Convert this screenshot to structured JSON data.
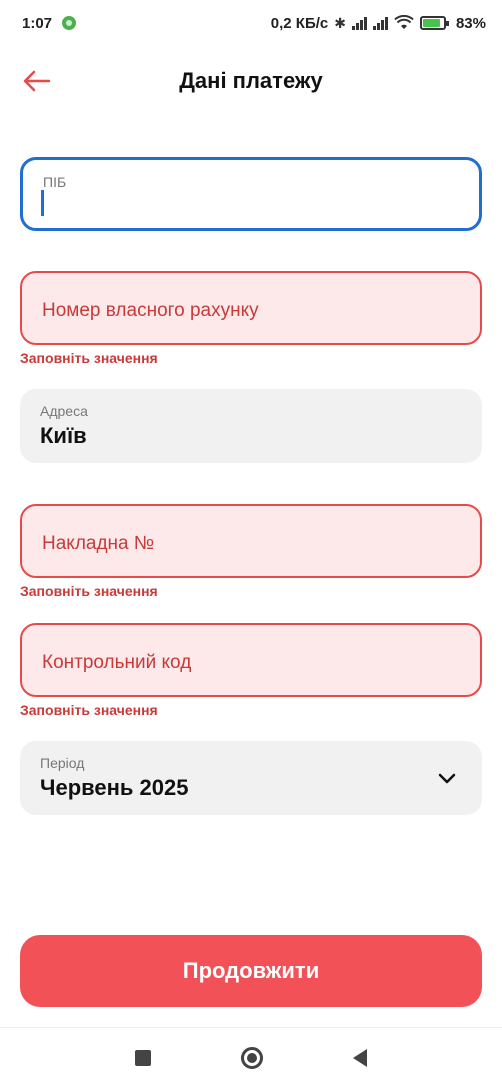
{
  "status_bar": {
    "time": "1:07",
    "speed": "0,2 КБ/с",
    "battery": "83%"
  },
  "header": {
    "title": "Дані платежу",
    "back_icon": "arrow-left-icon",
    "accent_color": "#e54b4b"
  },
  "form": {
    "full_name": {
      "label": "ПІБ",
      "value": ""
    },
    "account_number": {
      "placeholder": "Номер власного рахунку",
      "error": "Заповніть значення"
    },
    "address": {
      "label": "Адреса",
      "value": "Київ"
    },
    "invoice": {
      "placeholder": "Накладна №",
      "error": "Заповніть значення"
    },
    "control_code": {
      "placeholder": "Контрольний код",
      "error": "Заповніть значення"
    },
    "period": {
      "label": "Період",
      "value": "Червень 2025",
      "icon": "chevron-down-icon"
    }
  },
  "actions": {
    "continue_label": "Продовжити",
    "button_color": "#f25158"
  }
}
